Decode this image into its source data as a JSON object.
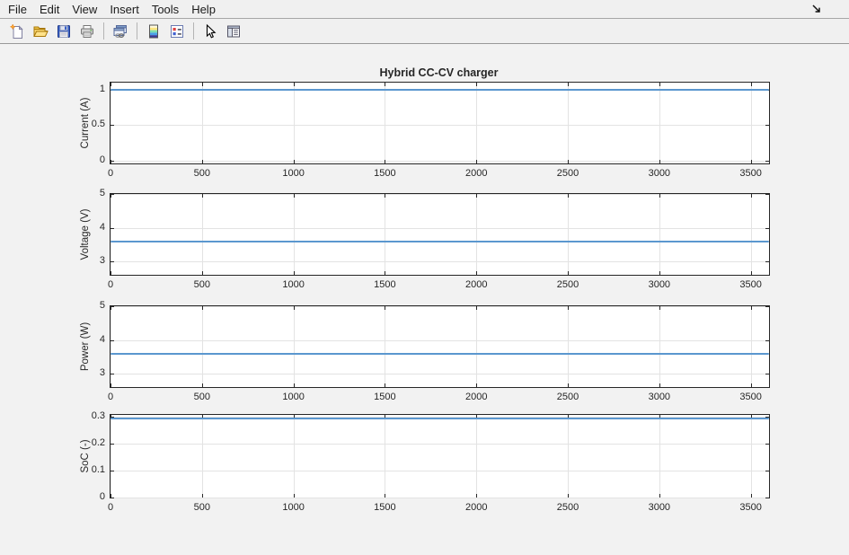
{
  "menubar": {
    "items": [
      "File",
      "Edit",
      "View",
      "Insert",
      "Tools",
      "Help"
    ]
  },
  "toolbar": {
    "icons": [
      "new-document-icon",
      "open-folder-icon",
      "save-icon",
      "print-icon",
      "copy-figure-icon",
      "colormap-icon",
      "properties-icon",
      "pointer-icon",
      "side-panel-icon"
    ]
  },
  "colors": {
    "figure_bg": "#f2f2f2",
    "chrome_bg": "#f0f0f0",
    "axes_bg": "#ffffff",
    "axis": "#262626",
    "grid": "#e3e3e3",
    "line": "#5b97cf",
    "text": "#262626"
  },
  "chart_data": {
    "type": "line",
    "title": "Hybrid CC-CV charger",
    "xlabel": "",
    "grid": true,
    "x": {
      "lim": [
        0,
        3600
      ],
      "ticks": [
        0,
        500,
        1000,
        1500,
        2000,
        2500,
        3000,
        3500
      ]
    },
    "subplots": [
      {
        "ylabel": "Current (A)",
        "ylim": [
          -0.04,
          1.1
        ],
        "yticks": [
          0,
          0.5,
          1
        ],
        "series": [
          {
            "name": "Current",
            "shape": "constant",
            "x_range": [
              0,
              3600
            ],
            "y": 1.0
          }
        ]
      },
      {
        "ylabel": "Voltage (V)",
        "ylim": [
          2.6,
          5.0
        ],
        "yticks": [
          3,
          4,
          5
        ],
        "series": [
          {
            "name": "Voltage",
            "shape": "constant",
            "x_range": [
              0,
              3600
            ],
            "y": 3.6
          }
        ]
      },
      {
        "ylabel": "Power (W)",
        "ylim": [
          2.6,
          5.0
        ],
        "yticks": [
          3,
          4,
          5
        ],
        "series": [
          {
            "name": "Power",
            "shape": "constant",
            "x_range": [
              0,
              3600
            ],
            "y": 3.6
          }
        ]
      },
      {
        "ylabel": "SoC (-)",
        "ylim": [
          0,
          0.308
        ],
        "yticks": [
          0,
          0.1,
          0.2,
          0.3
        ],
        "series": [
          {
            "name": "SoC",
            "shape": "constant",
            "x_range": [
              0,
              3600
            ],
            "y": 0.295
          }
        ]
      }
    ]
  }
}
